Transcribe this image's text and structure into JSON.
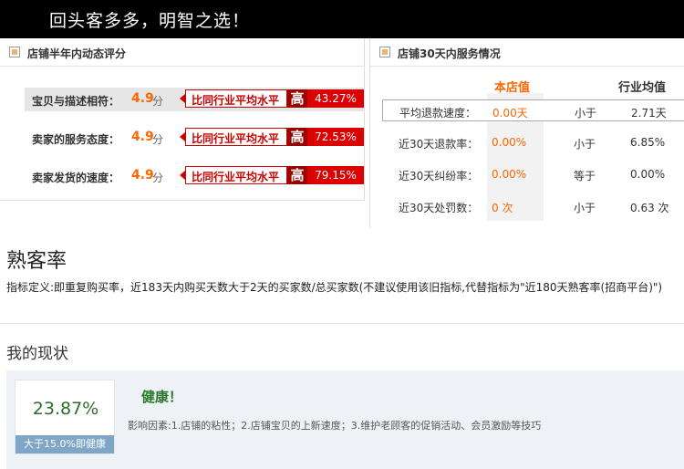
{
  "banner": {
    "slogan": "回头客多多，明智之选！"
  },
  "dynamic_rating": {
    "title": "店铺半年内动态评分",
    "unit": "分",
    "compare_label": "比同行业平均水平",
    "level_label": "高",
    "rows": [
      {
        "label": "宝贝与描述相符：",
        "score": "4.9",
        "percent": "43.27%"
      },
      {
        "label": "卖家的服务态度：",
        "score": "4.9",
        "percent": "72.53%"
      },
      {
        "label": "卖家发货的速度：",
        "score": "4.9",
        "percent": "79.15%"
      }
    ]
  },
  "service": {
    "title": "店铺30天内服务情况",
    "col_store": "本店值",
    "col_industry": "行业均值",
    "rows": [
      {
        "name": "平均退款速度：",
        "store": "0.00天",
        "relation": "小于",
        "industry": "2.71天"
      },
      {
        "name": "近30天退款率：",
        "store": "0.00%",
        "relation": "小于",
        "industry": "6.85%"
      },
      {
        "name": "近30天纠纷率：",
        "store": "0.00%",
        "relation": "等于",
        "industry": "0.00%"
      },
      {
        "name": "近30天处罚数：",
        "store": "0 次",
        "relation": "小于",
        "industry": "0.63 次"
      }
    ]
  },
  "repeat_rate": {
    "title": "熟客率",
    "definition": "指标定义:即重复购买率，近183天内购买天数大于2天的买家数/总买家数(不建议使用该旧指标,代替指标为\"近180天熟客率(招商平台)\")",
    "status_title": "我的现状",
    "value": "23.87%",
    "threshold": "大于15.0%即健康",
    "health": "健康！",
    "factors": "影响因素:1.店铺的粘性；2.店铺宝贝的上新速度；3.维护老顾客的促销活动、会员激励等技巧"
  },
  "colors": {
    "accent_red": "#d00000",
    "score_orange": "#ff6600",
    "healthy_green": "#2a7a2a"
  }
}
